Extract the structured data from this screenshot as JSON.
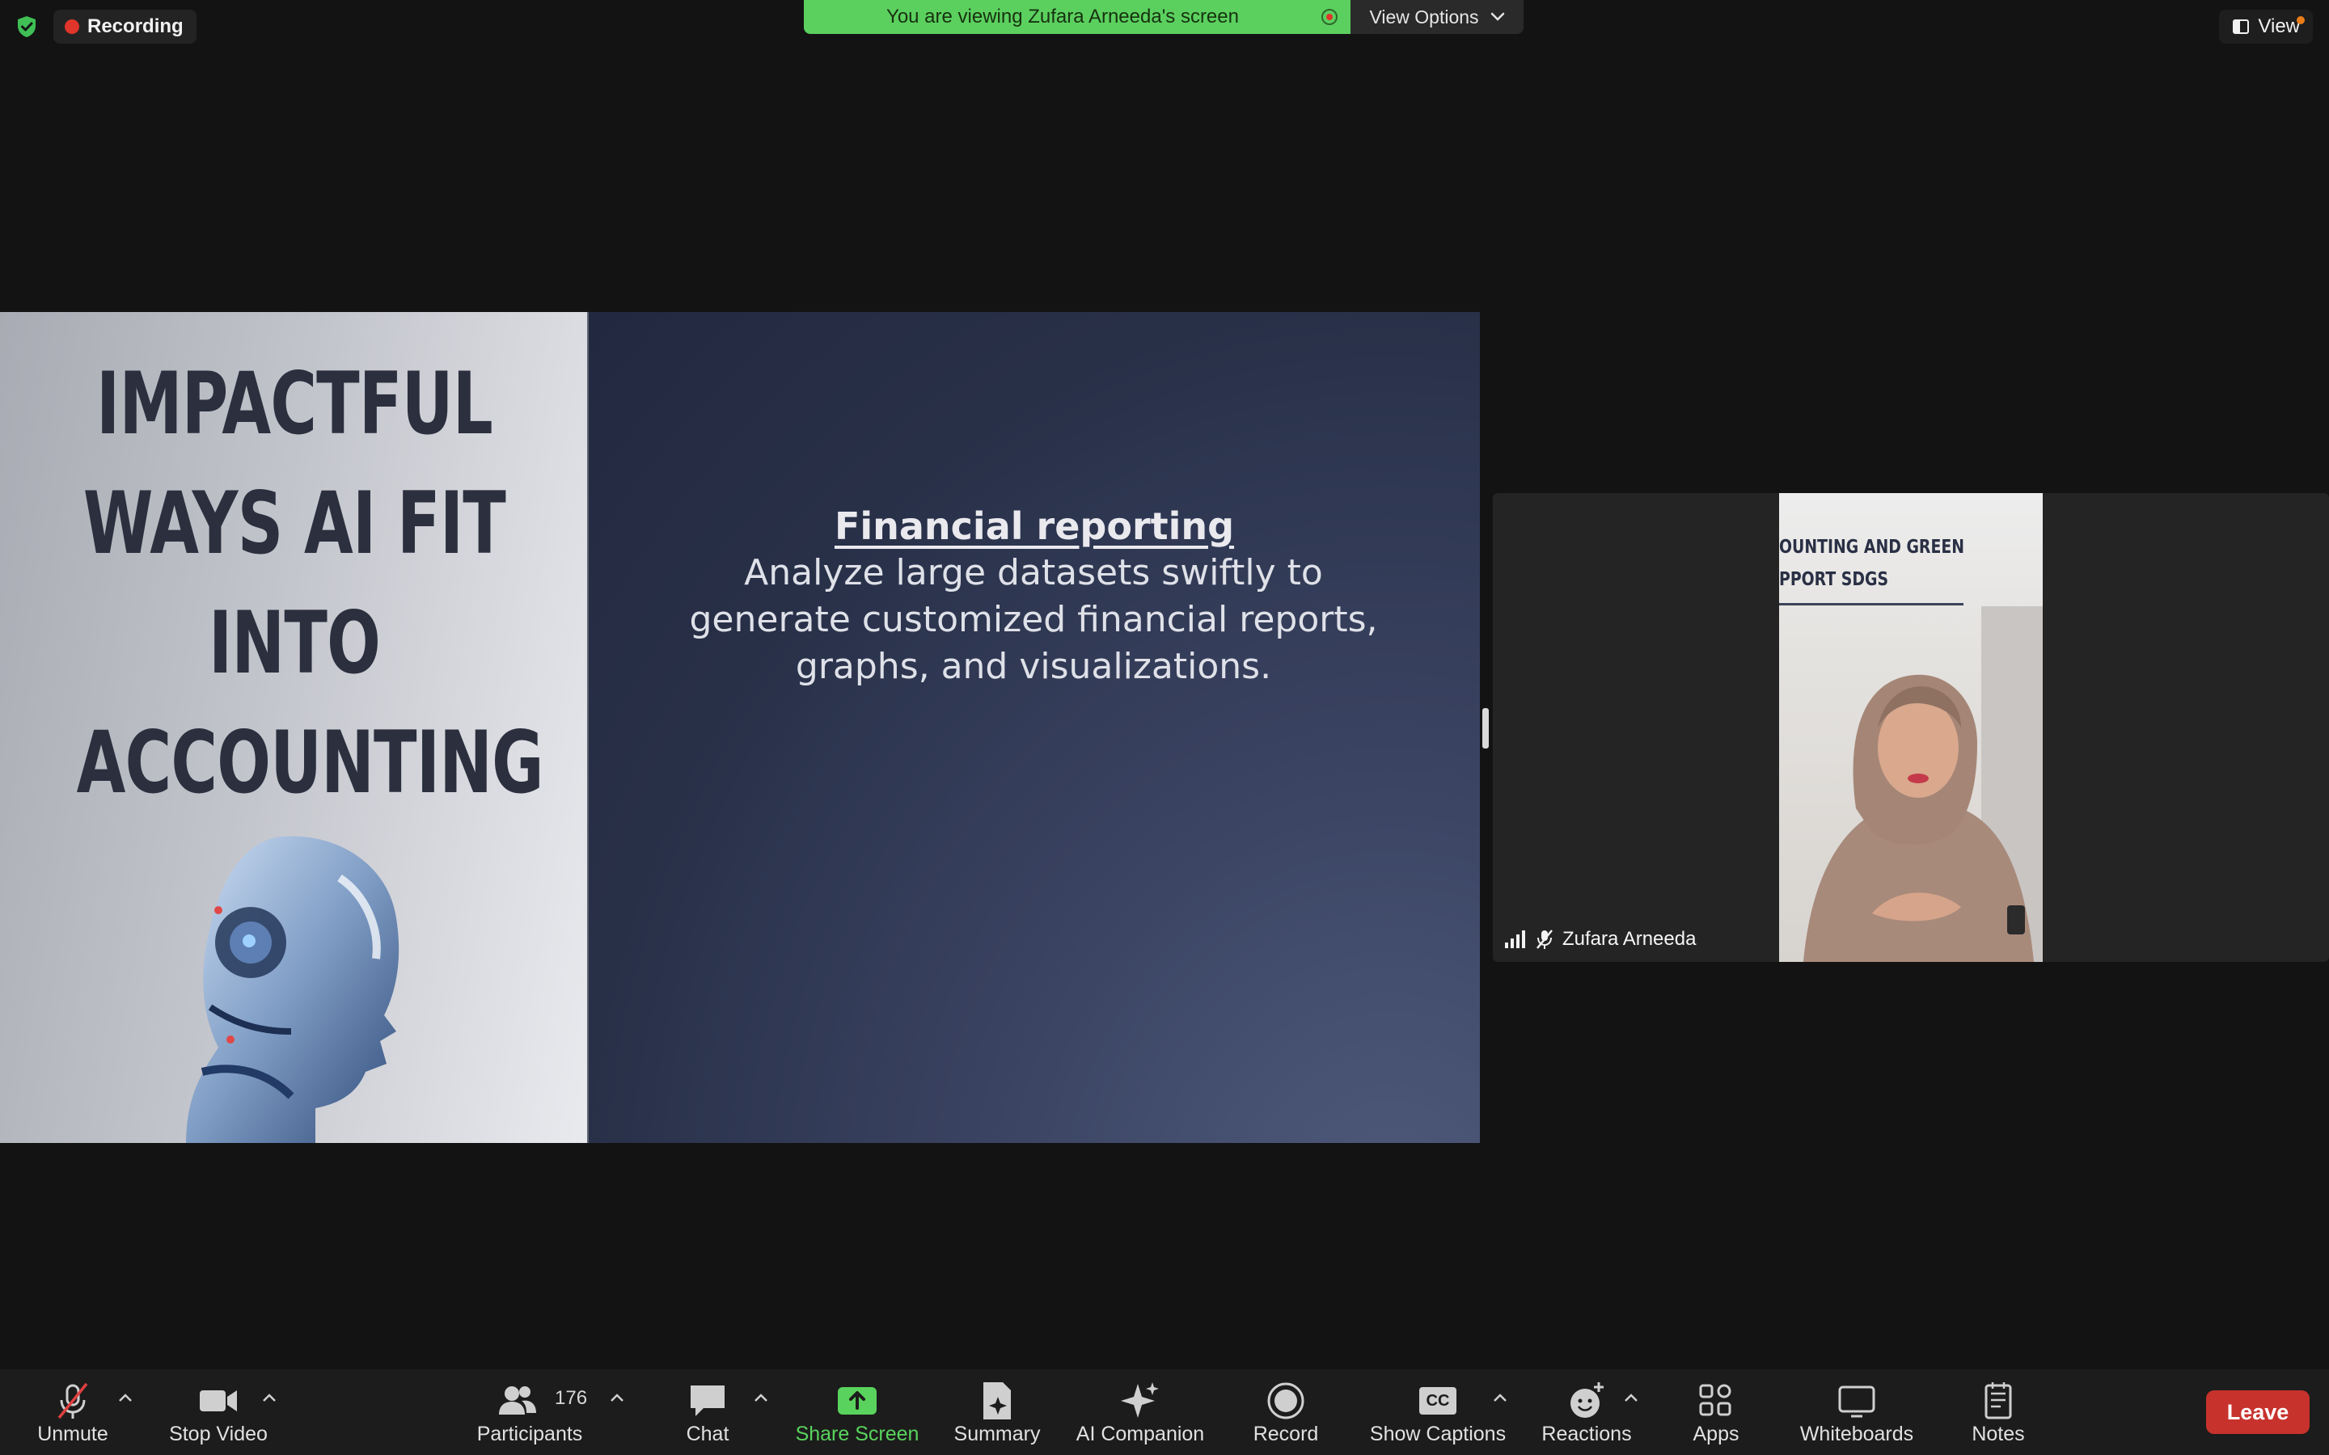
{
  "top_bar": {
    "recording_label": "Recording",
    "share_banner_text": "You are viewing Zufara Arneeda's screen",
    "view_options_label": "View Options",
    "view_label": "View"
  },
  "slide": {
    "title": "IMPACTFUL WAYS AI FIT INTO ACCOUNTING",
    "title_lines": [
      "IMPACTFUL",
      "WAYS AI FIT",
      "INTO",
      "ACCOUNTING"
    ],
    "heading": "Financial reporting",
    "body": "Analyze large datasets swiftly to generate customized financial reports, graphs, and visualizations."
  },
  "participant": {
    "name": "Zufara Arneeda",
    "video_caption_line1": "OUNTING AND GREEN",
    "video_caption_line2": "PPORT SDGS"
  },
  "toolbar": {
    "unmute": "Unmute",
    "stop_video": "Stop Video",
    "participants": "Participants",
    "participants_count": "176",
    "chat": "Chat",
    "share_screen": "Share Screen",
    "summary": "Summary",
    "ai_companion": "AI Companion",
    "record": "Record",
    "show_captions": "Show Captions",
    "captions_icon_text": "CC",
    "reactions": "Reactions",
    "apps": "Apps",
    "whiteboards": "Whiteboards",
    "notes": "Notes",
    "leave": "Leave"
  },
  "colors": {
    "banner_green": "#5bd05f",
    "share_screen_green": "#59d35d",
    "leave_red": "#c7322d",
    "recording_red": "#e0352b"
  }
}
